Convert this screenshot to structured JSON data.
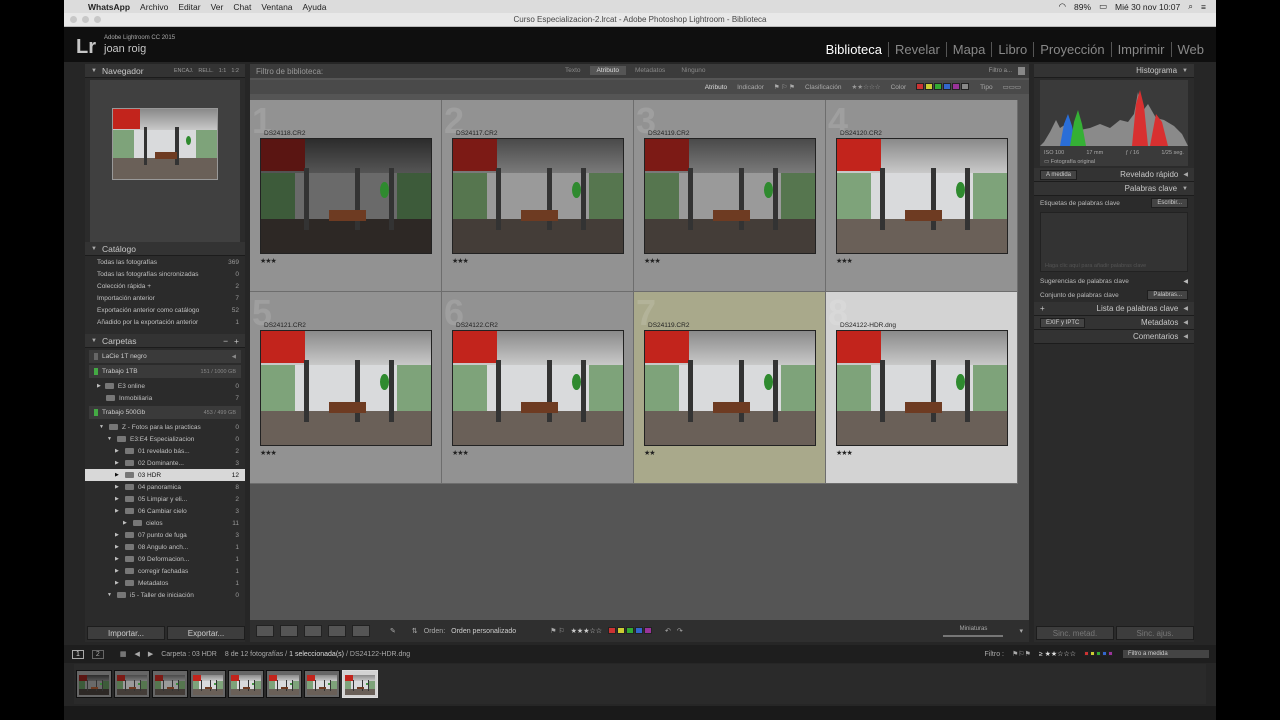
{
  "menubar": {
    "app": "WhatsApp",
    "items": [
      "Archivo",
      "Editar",
      "Ver",
      "Chat",
      "Ventana",
      "Ayuda"
    ],
    "battery": "89%",
    "clock": "Mié 30 nov  10:07"
  },
  "titlebar": "Curso Especializacion-2.lrcat - Adobe Photoshop Lightroom - Biblioteca",
  "identity": {
    "logo": "Lr",
    "version": "Adobe Lightroom CC 2015",
    "user": "joan roig"
  },
  "modules": [
    "Biblioteca",
    "Revelar",
    "Mapa",
    "Libro",
    "Proyección",
    "Imprimir",
    "Web"
  ],
  "left": {
    "navigator": {
      "title": "Navegador",
      "modes": [
        "ENCAJ.",
        "RELL.",
        "1:1",
        "1:2"
      ]
    },
    "catalog": {
      "title": "Catálogo",
      "items": [
        {
          "label": "Todas las fotografías",
          "count": "369"
        },
        {
          "label": "Todas las fotografías sincronizadas",
          "count": "0"
        },
        {
          "label": "Colección rápida  +",
          "count": "2"
        },
        {
          "label": "Importación anterior",
          "count": "7"
        },
        {
          "label": "Exportación anterior como catálogo",
          "count": "52"
        },
        {
          "label": "Añadido por la exportación anterior",
          "count": "1"
        }
      ]
    },
    "folders": {
      "title": "Carpetas",
      "lacie": "LaCie 1T negro",
      "drive1": {
        "label": "Trabajo 1TB",
        "size": "151 / 1000 GB"
      },
      "drive1_items": [
        {
          "label": "E3 online",
          "count": "0"
        },
        {
          "label": "Inmobiliaria",
          "count": "7"
        }
      ],
      "drive2": {
        "label": "Trabajo 500Gb",
        "size": "453 / 499 GB"
      },
      "drive2_items": [
        {
          "label": "Z - Fotos para las practicas",
          "count": "0",
          "indent": 1
        },
        {
          "label": "E3:E4 Especializacion",
          "count": "0",
          "indent": 2
        },
        {
          "label": "01 revelado bás...",
          "count": "2",
          "indent": 3
        },
        {
          "label": "02 Dominante...",
          "count": "3",
          "indent": 3
        },
        {
          "label": "03 HDR",
          "count": "12",
          "indent": 3,
          "selected": true
        },
        {
          "label": "04 panoramica",
          "count": "8",
          "indent": 3
        },
        {
          "label": "05 Limpiar y eli...",
          "count": "2",
          "indent": 3
        },
        {
          "label": "06 Cambiar cielo",
          "count": "3",
          "indent": 3
        },
        {
          "label": "cielos",
          "count": "11",
          "indent": 4
        },
        {
          "label": "07 punto de fuga",
          "count": "3",
          "indent": 3
        },
        {
          "label": "08 Angulo anch...",
          "count": "1",
          "indent": 3
        },
        {
          "label": "09 Deformacion...",
          "count": "1",
          "indent": 3
        },
        {
          "label": "corregir fachadas",
          "count": "1",
          "indent": 3
        },
        {
          "label": "Metadatos",
          "count": "1",
          "indent": 3
        },
        {
          "label": "i5 - Taller de iniciación",
          "count": "0",
          "indent": 2
        }
      ]
    },
    "import": "Importar...",
    "export": "Exportar..."
  },
  "center": {
    "filter_title": "Filtro de biblioteca:",
    "filter_tabs": [
      "Texto",
      "Atributo",
      "Metadatos",
      "Ninguno"
    ],
    "filter_preset": "Filtro a...",
    "attr": {
      "label": "Atributo",
      "flag": "Indicador",
      "rating": "Clasificación",
      "color": "Color",
      "type": "Tipo"
    },
    "cells": [
      {
        "idx": "1",
        "name": "DS24118.CR2",
        "stars": "★★★",
        "tone": "dark"
      },
      {
        "idx": "2",
        "name": "DS24117.CR2",
        "stars": "★★★",
        "tone": "mid"
      },
      {
        "idx": "3",
        "name": "DS24119.CR2",
        "stars": "★★★",
        "tone": "mid"
      },
      {
        "idx": "4",
        "name": "DS24120.CR2",
        "stars": "★★★",
        "tone": "light"
      },
      {
        "idx": "5",
        "name": "DS24121.CR2",
        "stars": "★★★",
        "tone": "light"
      },
      {
        "idx": "6",
        "name": "DS24122.CR2",
        "stars": "★★★",
        "tone": "light"
      },
      {
        "idx": "7",
        "name": "DS24119.CR2",
        "stars": "★★",
        "tone": "light",
        "hl": true
      },
      {
        "idx": "8",
        "name": "DS24122-HDR.dng",
        "stars": "★★★",
        "tone": "light",
        "cur": true
      }
    ],
    "toolbar": {
      "sort_label": "Orden:",
      "sort_value": "Orden personalizado",
      "thumbs_label": "Miniaturas"
    }
  },
  "right": {
    "histogram": "Histograma",
    "exif": {
      "iso": "ISO 100",
      "focal": "17 mm",
      "fstop": "ƒ / 16",
      "shutter": "1/25 seg."
    },
    "original": "Fotografía original",
    "quick": {
      "preset": "A medida",
      "title": "Revelado rápido"
    },
    "keywords": "Palabras clave",
    "kw_tags": "Etiquetas de palabras clave",
    "kw_enter": "Escribir...",
    "kw_hint": "Haga clic aquí para añadir palabras clave",
    "kw_suggest": "Sugerencias de palabras clave",
    "kw_set": "Conjunto de palabras clave",
    "kw_set_value": "Palabras...",
    "kw_list": "Lista de palabras clave",
    "meta_preset": "EXIF y IPTC",
    "meta": "Metadatos",
    "comments": "Comentarios",
    "sync_meta": "Sinc. metad.",
    "sync_set": "Sinc. ajus."
  },
  "filmstrip": {
    "pages": [
      "1",
      "2"
    ],
    "path": "Carpeta : 03 HDR",
    "count": "8 de 12 fotografías /",
    "selected": "1 seleccionada(s)",
    "file": "/ DS24122-HDR.dng",
    "filter": "Filtro :",
    "filter_value": "Filtro a medida"
  }
}
